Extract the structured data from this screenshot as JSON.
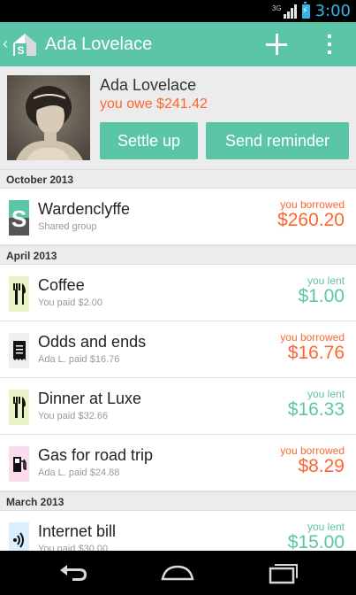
{
  "status_bar": {
    "network": "3G",
    "time": "3:00"
  },
  "action_bar": {
    "title": "Ada Lovelace",
    "back_icon": "chevron-left-icon",
    "add_icon": "plus-icon",
    "menu_icon": "overflow-menu-icon",
    "brand_color": "#5bc5a7"
  },
  "profile": {
    "name": "Ada Lovelace",
    "balance_text": "you owe $241.42",
    "settle_label": "Settle up",
    "reminder_label": "Send reminder"
  },
  "colors": {
    "owe": "#ff652f",
    "lent": "#5bc5a7"
  },
  "sections": [
    {
      "title": "October 2013",
      "items": [
        {
          "icon": "group-s-icon",
          "name": "Wardenclyffe",
          "sub": "Shared group",
          "direction": "you borrowed",
          "amount": "$260.20",
          "kind": "borrowed"
        }
      ]
    },
    {
      "title": "April 2013",
      "items": [
        {
          "icon": "fork-knife-icon",
          "name": "Coffee",
          "sub": "You paid $2.00",
          "direction": "you lent",
          "amount": "$1.00",
          "kind": "lent"
        },
        {
          "icon": "receipt-icon",
          "name": "Odds and ends",
          "sub": "Ada L. paid $16.76",
          "direction": "you borrowed",
          "amount": "$16.76",
          "kind": "borrowed"
        },
        {
          "icon": "fork-knife-icon",
          "name": "Dinner at Luxe",
          "sub": "You paid $32.66",
          "direction": "you lent",
          "amount": "$16.33",
          "kind": "lent"
        },
        {
          "icon": "gas-pump-icon",
          "name": "Gas for road trip",
          "sub": "Ada L. paid $24.88",
          "direction": "you borrowed",
          "amount": "$8.29",
          "kind": "borrowed"
        }
      ]
    },
    {
      "title": "March 2013",
      "items": [
        {
          "icon": "wifi-signal-icon",
          "name": "Internet bill",
          "sub": "You paid $30.00",
          "direction": "you lent",
          "amount": "$15.00",
          "kind": "lent"
        }
      ]
    }
  ],
  "nav_bar": {
    "back": "back-arrow-icon",
    "home": "home-icon",
    "recents": "recent-apps-icon"
  }
}
